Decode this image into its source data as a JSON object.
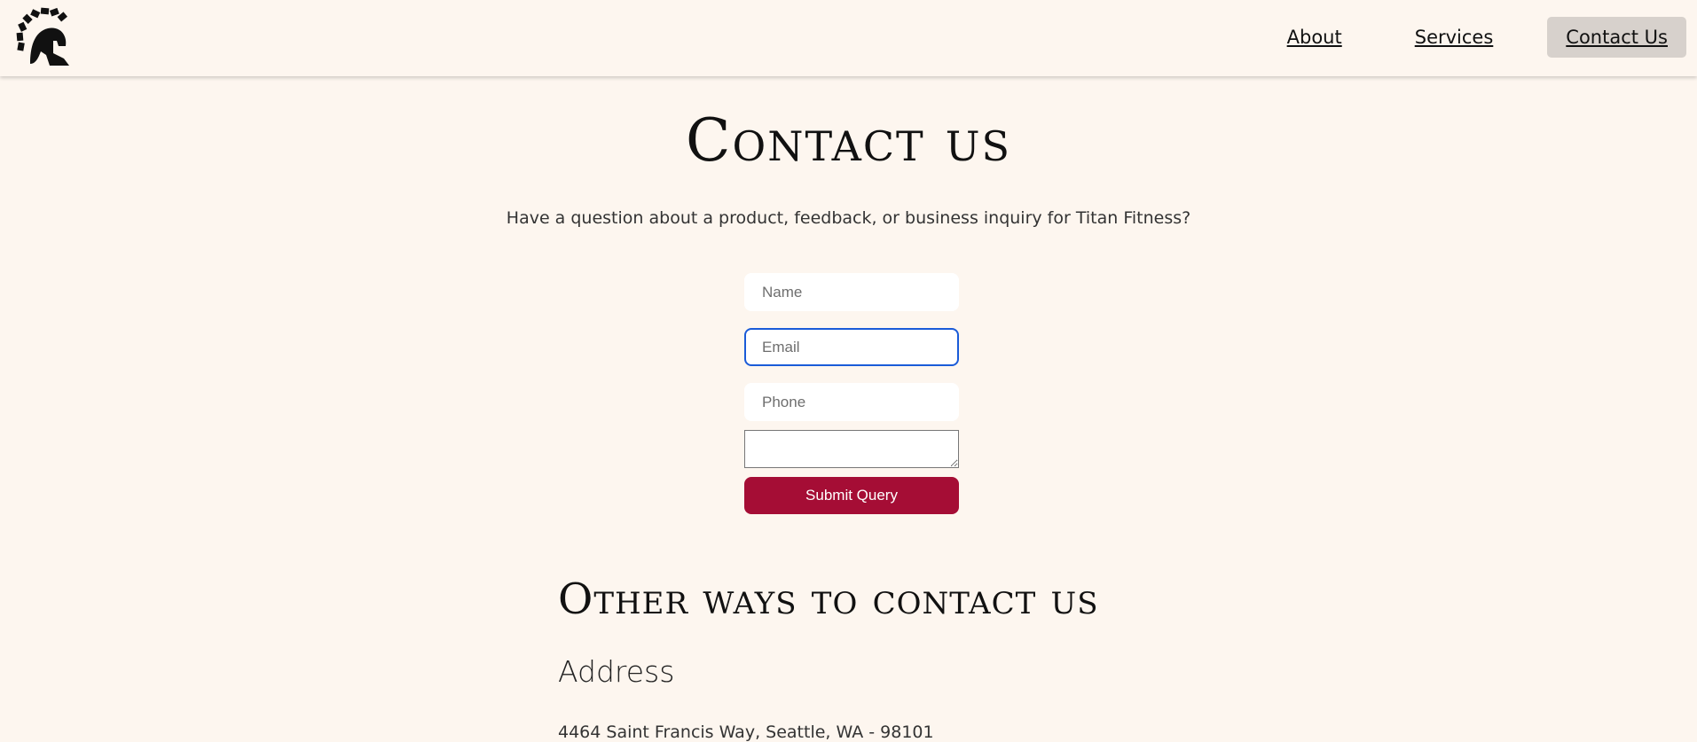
{
  "nav": {
    "items": [
      {
        "label": "About"
      },
      {
        "label": "Services"
      },
      {
        "label": "Contact Us",
        "active": true
      }
    ]
  },
  "logo": {
    "icon": "spartan-helmet-icon"
  },
  "main": {
    "title": "Contact us",
    "subtitle": "Have a question about a product, feedback, or business inquiry for Titan Fitness?"
  },
  "form": {
    "name_placeholder": "Name",
    "email_placeholder": "Email",
    "phone_placeholder": "Phone",
    "submit_label": "Submit Query"
  },
  "other": {
    "title": "Other ways to contact us",
    "address_heading": "Address",
    "address_text": "4464 Saint Francis Way, Seattle, WA - 98101"
  },
  "colors": {
    "background": "#fdf6ef",
    "accent": "#a50d35",
    "focus": "#1a5bd8",
    "nav_active_bg": "#d7d1cc"
  }
}
